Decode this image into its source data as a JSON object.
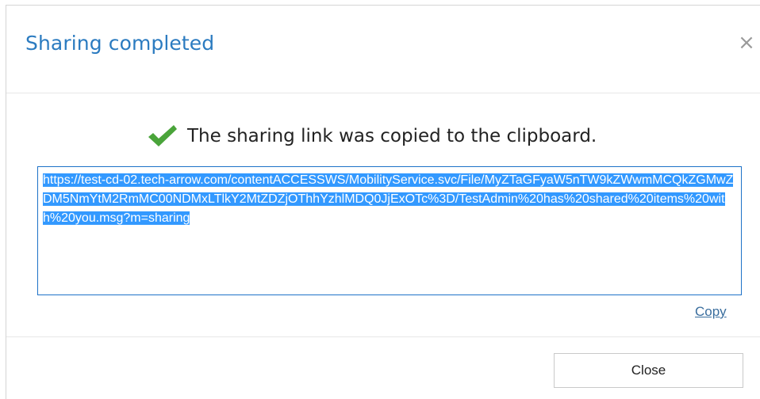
{
  "dialog": {
    "title": "Sharing completed",
    "close_icon_glyph": "×",
    "message": "The sharing link was copied to the clipboard.",
    "link_url": "https://test-cd-02.tech-arrow.com/contentACCESSWS/MobilityService.svc/File/MyZTaGFyaW5nTW9kZWwmMCQkZGMwZDM5NmYtM2RmMC00NDMxLTlkY2MtZDZjOThhYzhlMDQ0JjExOTc%3D/TestAdmin%20has%20shared%20items%20with%20you.msg?m=sharing",
    "copy_label": "Copy",
    "close_button_label": "Close"
  },
  "colors": {
    "title": "#2b7bc0",
    "check": "#4aa43a",
    "selection": "#3399ff",
    "link_border": "#1e72c8",
    "copy_link": "#3a6e9e"
  },
  "icons": {
    "check": "check-icon",
    "close": "close-icon"
  }
}
